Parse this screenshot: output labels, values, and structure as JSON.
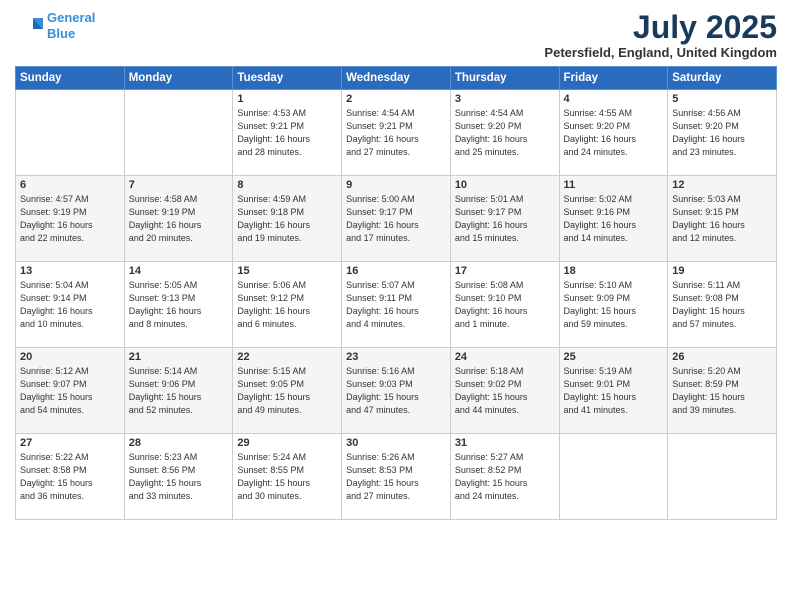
{
  "logo": {
    "line1": "General",
    "line2": "Blue"
  },
  "title": "July 2025",
  "location": "Petersfield, England, United Kingdom",
  "headers": [
    "Sunday",
    "Monday",
    "Tuesday",
    "Wednesday",
    "Thursday",
    "Friday",
    "Saturday"
  ],
  "weeks": [
    [
      {
        "day": "",
        "info": ""
      },
      {
        "day": "",
        "info": ""
      },
      {
        "day": "1",
        "info": "Sunrise: 4:53 AM\nSunset: 9:21 PM\nDaylight: 16 hours\nand 28 minutes."
      },
      {
        "day": "2",
        "info": "Sunrise: 4:54 AM\nSunset: 9:21 PM\nDaylight: 16 hours\nand 27 minutes."
      },
      {
        "day": "3",
        "info": "Sunrise: 4:54 AM\nSunset: 9:20 PM\nDaylight: 16 hours\nand 25 minutes."
      },
      {
        "day": "4",
        "info": "Sunrise: 4:55 AM\nSunset: 9:20 PM\nDaylight: 16 hours\nand 24 minutes."
      },
      {
        "day": "5",
        "info": "Sunrise: 4:56 AM\nSunset: 9:20 PM\nDaylight: 16 hours\nand 23 minutes."
      }
    ],
    [
      {
        "day": "6",
        "info": "Sunrise: 4:57 AM\nSunset: 9:19 PM\nDaylight: 16 hours\nand 22 minutes."
      },
      {
        "day": "7",
        "info": "Sunrise: 4:58 AM\nSunset: 9:19 PM\nDaylight: 16 hours\nand 20 minutes."
      },
      {
        "day": "8",
        "info": "Sunrise: 4:59 AM\nSunset: 9:18 PM\nDaylight: 16 hours\nand 19 minutes."
      },
      {
        "day": "9",
        "info": "Sunrise: 5:00 AM\nSunset: 9:17 PM\nDaylight: 16 hours\nand 17 minutes."
      },
      {
        "day": "10",
        "info": "Sunrise: 5:01 AM\nSunset: 9:17 PM\nDaylight: 16 hours\nand 15 minutes."
      },
      {
        "day": "11",
        "info": "Sunrise: 5:02 AM\nSunset: 9:16 PM\nDaylight: 16 hours\nand 14 minutes."
      },
      {
        "day": "12",
        "info": "Sunrise: 5:03 AM\nSunset: 9:15 PM\nDaylight: 16 hours\nand 12 minutes."
      }
    ],
    [
      {
        "day": "13",
        "info": "Sunrise: 5:04 AM\nSunset: 9:14 PM\nDaylight: 16 hours\nand 10 minutes."
      },
      {
        "day": "14",
        "info": "Sunrise: 5:05 AM\nSunset: 9:13 PM\nDaylight: 16 hours\nand 8 minutes."
      },
      {
        "day": "15",
        "info": "Sunrise: 5:06 AM\nSunset: 9:12 PM\nDaylight: 16 hours\nand 6 minutes."
      },
      {
        "day": "16",
        "info": "Sunrise: 5:07 AM\nSunset: 9:11 PM\nDaylight: 16 hours\nand 4 minutes."
      },
      {
        "day": "17",
        "info": "Sunrise: 5:08 AM\nSunset: 9:10 PM\nDaylight: 16 hours\nand 1 minute."
      },
      {
        "day": "18",
        "info": "Sunrise: 5:10 AM\nSunset: 9:09 PM\nDaylight: 15 hours\nand 59 minutes."
      },
      {
        "day": "19",
        "info": "Sunrise: 5:11 AM\nSunset: 9:08 PM\nDaylight: 15 hours\nand 57 minutes."
      }
    ],
    [
      {
        "day": "20",
        "info": "Sunrise: 5:12 AM\nSunset: 9:07 PM\nDaylight: 15 hours\nand 54 minutes."
      },
      {
        "day": "21",
        "info": "Sunrise: 5:14 AM\nSunset: 9:06 PM\nDaylight: 15 hours\nand 52 minutes."
      },
      {
        "day": "22",
        "info": "Sunrise: 5:15 AM\nSunset: 9:05 PM\nDaylight: 15 hours\nand 49 minutes."
      },
      {
        "day": "23",
        "info": "Sunrise: 5:16 AM\nSunset: 9:03 PM\nDaylight: 15 hours\nand 47 minutes."
      },
      {
        "day": "24",
        "info": "Sunrise: 5:18 AM\nSunset: 9:02 PM\nDaylight: 15 hours\nand 44 minutes."
      },
      {
        "day": "25",
        "info": "Sunrise: 5:19 AM\nSunset: 9:01 PM\nDaylight: 15 hours\nand 41 minutes."
      },
      {
        "day": "26",
        "info": "Sunrise: 5:20 AM\nSunset: 8:59 PM\nDaylight: 15 hours\nand 39 minutes."
      }
    ],
    [
      {
        "day": "27",
        "info": "Sunrise: 5:22 AM\nSunset: 8:58 PM\nDaylight: 15 hours\nand 36 minutes."
      },
      {
        "day": "28",
        "info": "Sunrise: 5:23 AM\nSunset: 8:56 PM\nDaylight: 15 hours\nand 33 minutes."
      },
      {
        "day": "29",
        "info": "Sunrise: 5:24 AM\nSunset: 8:55 PM\nDaylight: 15 hours\nand 30 minutes."
      },
      {
        "day": "30",
        "info": "Sunrise: 5:26 AM\nSunset: 8:53 PM\nDaylight: 15 hours\nand 27 minutes."
      },
      {
        "day": "31",
        "info": "Sunrise: 5:27 AM\nSunset: 8:52 PM\nDaylight: 15 hours\nand 24 minutes."
      },
      {
        "day": "",
        "info": ""
      },
      {
        "day": "",
        "info": ""
      }
    ]
  ]
}
